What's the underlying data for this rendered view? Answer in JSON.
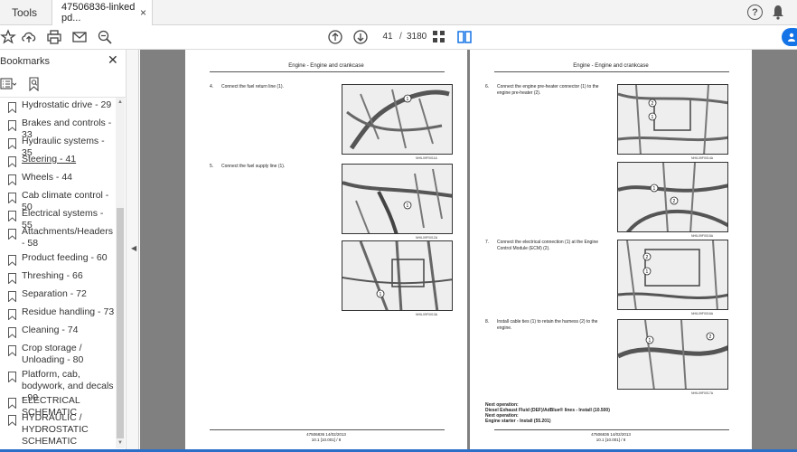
{
  "top_tabs": {
    "tools_label": "Tools",
    "document_tab_label": "47506836-linked pd...",
    "close_symbol": "×"
  },
  "toolbar": {
    "current_page": "41",
    "page_separator": "/",
    "total_pages": "3180"
  },
  "bookmarks_panel": {
    "title": "Bookmarks",
    "close_symbol": "✕",
    "items": [
      {
        "label": "Hydrostatic drive - 29"
      },
      {
        "label": "Brakes and controls - 33"
      },
      {
        "label": "Hydraulic systems - 35"
      },
      {
        "label": "Steering - 41"
      },
      {
        "label": "Wheels - 44"
      },
      {
        "label": "Cab climate control - 50"
      },
      {
        "label": "Electrical systems - 55"
      },
      {
        "label": "Attachments/Headers - 58"
      },
      {
        "label": "Product feeding - 60"
      },
      {
        "label": "Threshing - 66"
      },
      {
        "label": "Separation - 72"
      },
      {
        "label": "Residue handling - 73"
      },
      {
        "label": "Cleaning - 74"
      },
      {
        "label": "Crop storage / Unloading - 80"
      },
      {
        "label": "Platform, cab, bodywork, and decals - 90"
      },
      {
        "label": "ELECTRICAL SCHEMATIC"
      },
      {
        "label": "HYDRAULIC / HYDROSTATIC SCHEMATIC"
      }
    ]
  },
  "left_page": {
    "header": "Engine - Engine and crankcase",
    "steps": [
      {
        "num": "4.",
        "text": "Connect the fuel return line (1)."
      },
      {
        "num": "5.",
        "text": "Connect the fuel supply line (1)."
      }
    ],
    "captions": [
      "NHIL09F0011A",
      "NHIL09F0012A",
      "NHIL09F0013A"
    ],
    "footer_line1": "47506836 14/02/2013",
    "footer_line2": "10.1 [10.001] / 8"
  },
  "right_page": {
    "header": "Engine - Engine and crankcase",
    "steps": [
      {
        "num": "6.",
        "text": "Connect the engine pre-heater connector (1) to the engine pre-heater (2)."
      },
      {
        "num": "7.",
        "text": "Connect the electrical connection (1) at the Engine Control Module (ECM) (2)."
      },
      {
        "num": "8.",
        "text": "Install cable ties (1) to retain the harness (2) to the engine."
      }
    ],
    "captions": [
      "NHIL09F0014A",
      "NHIL09F0015A",
      "NHIL09F0016A",
      "NHIL09F0017A"
    ],
    "next_operation": [
      "Next operation:",
      "Diesel Exhaust Fluid (DEF)/AdBlue® lines - Install (10.500)",
      "Next operation:",
      "Engine starter - Install (55.201)"
    ],
    "footer_line1": "47506836 14/02/2013",
    "footer_line2": "10.1 [10.001] / 8"
  },
  "colors": {
    "accent": "#1473e6",
    "document_background": "#808080",
    "panel_background": "#ffffff"
  },
  "icons": [
    "star-icon",
    "upload-icon",
    "print-icon",
    "email-icon",
    "zoom-icon",
    "page-up-icon",
    "page-down-icon",
    "page-thumbnail-icon",
    "two-page-icon",
    "help-icon",
    "bell-icon",
    "bookmark-options-icon",
    "bookmark-search-icon",
    "bookmark-icon"
  ]
}
